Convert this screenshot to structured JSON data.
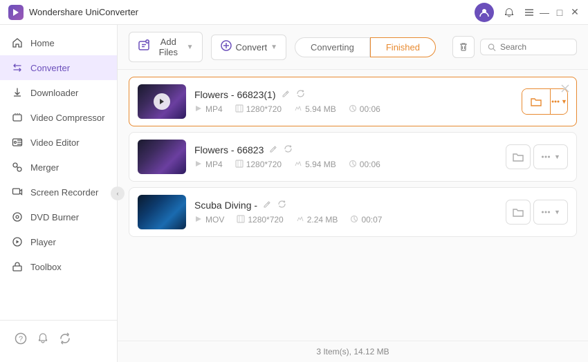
{
  "app": {
    "title": "Wondershare UniConverter",
    "logo_letter": "W"
  },
  "titlebar": {
    "controls": {
      "user_icon": "👤",
      "notification_icon": "🔔",
      "menu_icon": "☰",
      "minimize": "—",
      "maximize": "□",
      "close": "✕"
    }
  },
  "sidebar": {
    "items": [
      {
        "id": "home",
        "label": "Home",
        "icon": "🏠",
        "active": false
      },
      {
        "id": "converter",
        "label": "Converter",
        "icon": "⇄",
        "active": true
      },
      {
        "id": "downloader",
        "label": "Downloader",
        "icon": "⬇",
        "active": false
      },
      {
        "id": "video-compressor",
        "label": "Video Compressor",
        "icon": "📦",
        "active": false
      },
      {
        "id": "video-editor",
        "label": "Video Editor",
        "icon": "✂",
        "active": false
      },
      {
        "id": "merger",
        "label": "Merger",
        "icon": "⊕",
        "active": false
      },
      {
        "id": "screen-recorder",
        "label": "Screen Recorder",
        "icon": "📹",
        "active": false
      },
      {
        "id": "dvd-burner",
        "label": "DVD Burner",
        "icon": "💿",
        "active": false
      },
      {
        "id": "player",
        "label": "Player",
        "icon": "▶",
        "active": false
      },
      {
        "id": "toolbox",
        "label": "Toolbox",
        "icon": "🧰",
        "active": false
      }
    ],
    "bottom_icons": [
      "?",
      "🔔",
      "🔄"
    ]
  },
  "toolbar": {
    "add_files_label": "Add Files",
    "add_files_icon": "+",
    "add_convert_label": "Convert",
    "add_convert_icon": "⊕",
    "tab_converting": "Converting",
    "tab_finished": "Finished",
    "trash_icon": "🗑",
    "search_placeholder": "Search"
  },
  "files": [
    {
      "id": 1,
      "name": "Flowers - 66823(1)",
      "format": "MP4",
      "resolution": "1280*720",
      "size": "5.94 MB",
      "duration": "00:06",
      "thumbnail_class": "flowers1",
      "selected": true
    },
    {
      "id": 2,
      "name": "Flowers - 66823",
      "format": "MP4",
      "resolution": "1280*720",
      "size": "5.94 MB",
      "duration": "00:06",
      "thumbnail_class": "flowers2",
      "selected": false
    },
    {
      "id": 3,
      "name": "Scuba Diving -",
      "format": "MOV",
      "resolution": "1280*720",
      "size": "2.24 MB",
      "duration": "00:07",
      "thumbnail_class": "scuba",
      "selected": false
    }
  ],
  "footer": {
    "summary": "3 Item(s), 14.12 MB"
  }
}
